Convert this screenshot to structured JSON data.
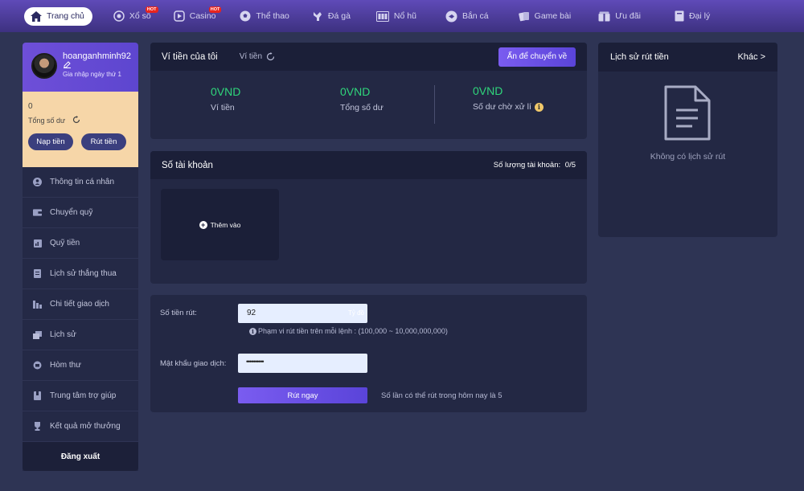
{
  "nav": {
    "home": "Trang chủ",
    "items": [
      {
        "label": "Xổ số",
        "icon": "lottery-icon",
        "hot": "HOT"
      },
      {
        "label": "Casino",
        "icon": "casino-icon",
        "hot": "HOT"
      },
      {
        "label": "Thể thao",
        "icon": "soccer-ball-icon"
      },
      {
        "label": "Đá gà",
        "icon": "rooster-icon"
      },
      {
        "label": "Nổ hũ",
        "icon": "slot-machine-icon"
      },
      {
        "label": "Bắn cá",
        "icon": "fish-icon"
      },
      {
        "label": "Game bài",
        "icon": "cards-icon"
      },
      {
        "label": "Ưu đãi",
        "icon": "gift-icon"
      },
      {
        "label": "Đại lý",
        "icon": "book-icon"
      }
    ]
  },
  "profile": {
    "username": "hoanganhminh92",
    "joined": "Gia nhập ngày thứ 1",
    "balance": "0",
    "balance_label": "Tổng số dư",
    "deposit": "Nạp tiền",
    "withdraw": "Rút tiền"
  },
  "sidebar": {
    "items": [
      {
        "label": "Thông tin cá nhân",
        "icon": "user-icon"
      },
      {
        "label": "Chuyển quỹ",
        "icon": "wallet-icon"
      },
      {
        "label": "Quỹ tiền",
        "icon": "fund-icon"
      },
      {
        "label": "Lịch sử thắng thua",
        "icon": "history-doc-icon"
      },
      {
        "label": "Chi tiết giao dịch",
        "icon": "transaction-icon"
      },
      {
        "label": "Lịch sử",
        "icon": "history-icon"
      },
      {
        "label": "Hòm thư",
        "icon": "mailbox-icon"
      },
      {
        "label": "Trung tâm trợ giúp",
        "icon": "help-book-icon"
      },
      {
        "label": "Kết quả mở thưởng",
        "icon": "trophy-icon"
      }
    ],
    "logout": "Đăng xuất"
  },
  "wallet": {
    "title": "Ví tiền của tôi",
    "tab": "Ví tiền",
    "transfer_btn": "Ấn để chuyển về",
    "stats": [
      {
        "value": "0VND",
        "label": "Ví tiền"
      },
      {
        "value": "0VND",
        "label": "Tổng số dư"
      },
      {
        "value": "0VND",
        "label": "Số dư chờ xử lí"
      }
    ]
  },
  "accounts": {
    "title": "Số tài khoản",
    "count_label": "Số lượng tài khoản:",
    "count": "0/5",
    "add": "Thêm vào"
  },
  "withdraw": {
    "amount_label": "Số tiền rút:",
    "amount_value": "92",
    "amount_suffix": "Tỷ đồ",
    "range_note": "Phạm vi rút tiền trên mỗi lệnh : (100,000 ~ 10,000,000,000)",
    "password_label": "Mật khẩu giao dịch:",
    "password_value": "••••••••••",
    "submit": "Rút ngay",
    "remaining": "Số lần có thể rút trong hôm nay là 5"
  },
  "history": {
    "title": "Lịch sử rút tiền",
    "more": "Khác >",
    "empty": "Không có lịch sử rút"
  },
  "colors": {
    "accent": "#6a50e6",
    "green": "#2fd67b",
    "nav": "#5a46b0",
    "bg": "#2e3454"
  }
}
